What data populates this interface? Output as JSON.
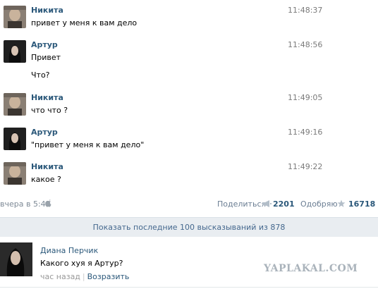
{
  "messages": [
    {
      "author": "Никита",
      "time": "11:48:37",
      "lines": [
        "привет у меня к вам дело"
      ],
      "avatar": "nikita"
    },
    {
      "author": "Артур",
      "time": "11:48:56",
      "lines": [
        "Привет",
        "Что?"
      ],
      "avatar": "artur"
    },
    {
      "author": "Никита",
      "time": "11:49:05",
      "lines": [
        "что что ?"
      ],
      "avatar": "nikita"
    },
    {
      "author": "Артур",
      "time": "11:49:16",
      "lines": [
        "\"привет у меня к вам дело\""
      ],
      "avatar": "artur"
    },
    {
      "author": "Никита",
      "time": "11:49:22",
      "lines": [
        "какое ?"
      ],
      "avatar": "nikita"
    }
  ],
  "post_footer": {
    "date": "вчера в 5:41",
    "share_label": "Поделиться",
    "share_count": "2201",
    "like_label": "Одобряю",
    "like_count": "16718"
  },
  "show_more": "Показать последние 100 высказываний из 878",
  "comment": {
    "author": "Диана Перчик",
    "text": "Какого хуя я Артур?",
    "time": "час назад",
    "reply": "Возразить"
  },
  "watermark": "YAPLAKAL.COM",
  "colors": {
    "link": "#2b587a",
    "meta": "#7a7a7a",
    "show_more_bg": "#e9edf1"
  }
}
